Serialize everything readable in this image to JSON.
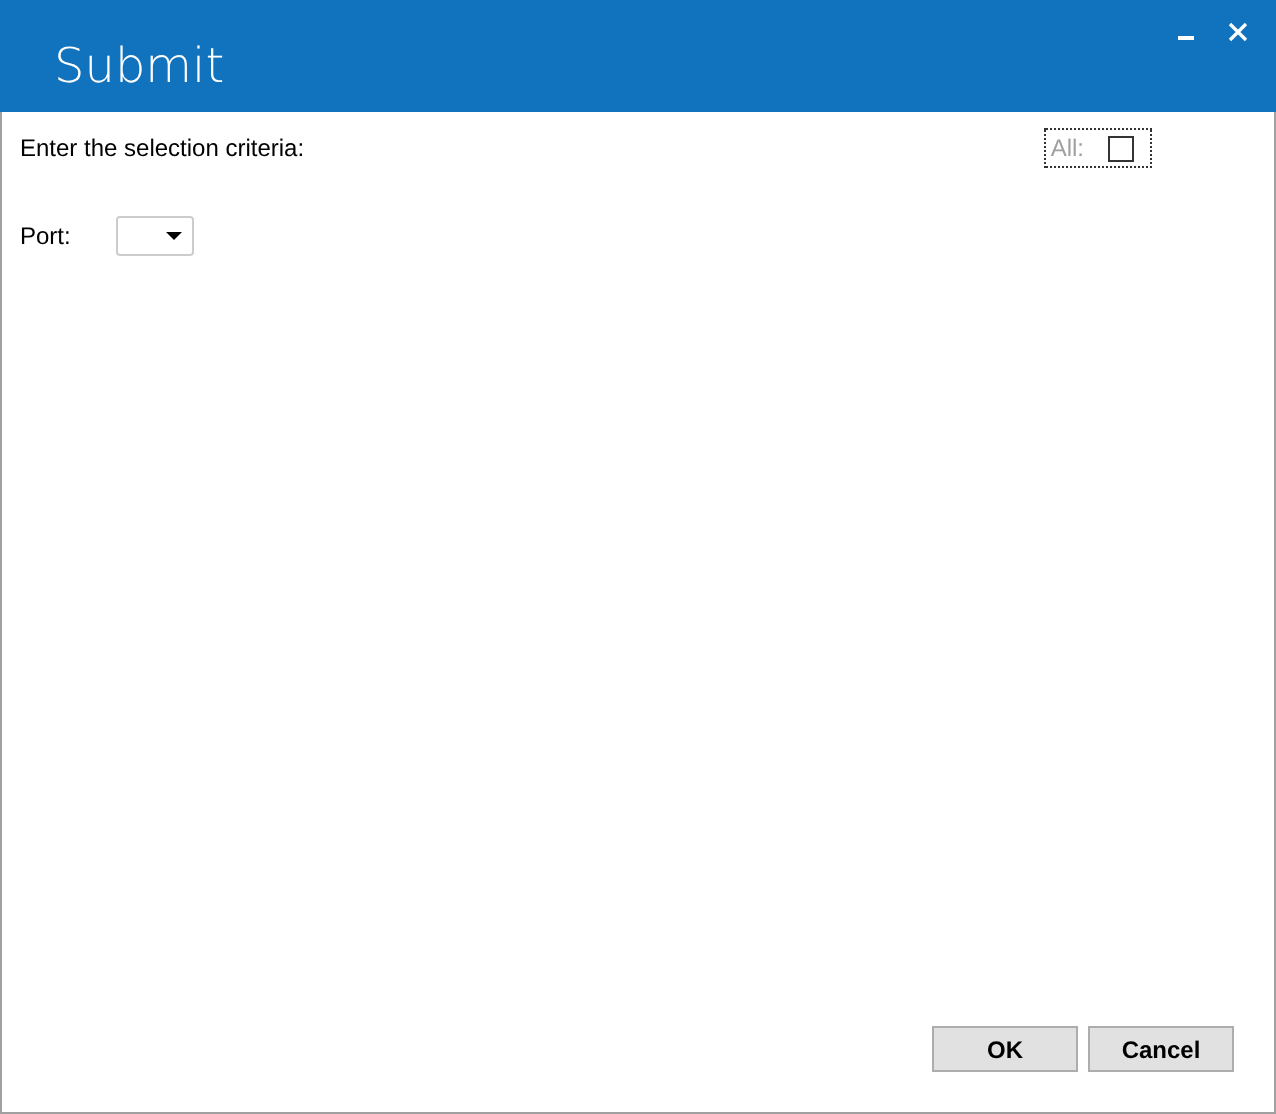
{
  "window": {
    "title": "Submit"
  },
  "prompt": "Enter the selection criteria:",
  "all_checkbox": {
    "label": "All:",
    "checked": false,
    "disabled": true,
    "focused": true
  },
  "port": {
    "label": "Port:"
  },
  "buttons": [
    "OK",
    "Cancel"
  ]
}
